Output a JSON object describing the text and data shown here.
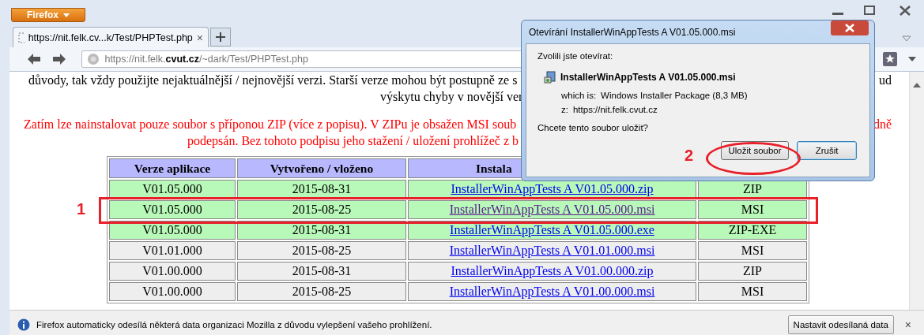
{
  "browser": {
    "menu_button": "Firefox",
    "tab": {
      "title": "https://nit.felk.cv...k/Test/PHPTest.php",
      "close": "×",
      "selected": true
    },
    "url": "https://nit.felk.**cvut.cz**/~dark/Test/PHPTest.php"
  },
  "page": {
    "lines": [
      {
        "kind": "black",
        "text": "důvody, tak vždy použijte nejaktuálnější / nejnovější verzi. Starší verze mohou být postupně ze s",
        "tail": "ud"
      },
      {
        "kind": "black",
        "text": "výskytu chyby v novější ver"
      },
      {
        "kind": "red",
        "text": "Zatím lze nainstalovat pouze soubor s příponou ZIP (více z popisu). V ZIPu je obsažen MSI soub",
        "tail": "dně"
      },
      {
        "kind": "red",
        "text": "podepsán. Bez tohoto podpisu jeho stažení / uložení prohlížeč z b"
      }
    ]
  },
  "table": {
    "columns": [
      "Verze aplikace",
      "Vytvořeno / vloženo",
      "Instala",
      ""
    ],
    "rows": [
      {
        "color": "#b8f8b8",
        "cells": [
          "V01.05.000",
          "2015-08-31",
          "InstallerWinAppTests A V01.05.000.zip",
          "ZIP"
        ],
        "visited": false
      },
      {
        "color": "#b8f8b8",
        "cells": [
          "V01.05.000",
          "2015-08-25",
          "InstallerWinAppTests A V01.05.000.msi",
          "MSI"
        ],
        "visited": true
      },
      {
        "color": "#b8f8b8",
        "cells": [
          "V01.05.000",
          "2015-08-31",
          "InstallerWinAppTests A V01.05.000.exe",
          "ZIP-EXE"
        ],
        "visited": false
      },
      {
        "color": "#eeeeee",
        "cells": [
          "V01.01.000",
          "2015-08-25",
          "InstallerWinAppTests A V01.01.000.msi",
          "MSI"
        ],
        "visited": false
      },
      {
        "color": "#eeeeee",
        "cells": [
          "V01.00.000",
          "2015-08-31",
          "InstallerWinAppTests A V01.00.000.zip",
          "ZIP"
        ],
        "visited": false
      },
      {
        "color": "#eeeeee",
        "cells": [
          "V01.00.000",
          "2015-08-25",
          "InstallerWinAppTests A V01.00.000.msi",
          "MSI"
        ],
        "visited": false
      }
    ]
  },
  "dialog": {
    "title": "Otevírání InstallerWinAppTests A V01.05.000.msi",
    "prompt": "Zvolili jste otevírat:",
    "filename": "InstallerWinAppTests A V01.05.000.msi",
    "type_label": "which is:",
    "type_value": "Windows Installer Package (8,3 MB)",
    "from_label": "z:",
    "from_value": "https://nit.felk.cvut.cz",
    "question": "Chcete tento soubor uložit?",
    "buttons": [
      {
        "label": "Uložit soubor",
        "default": false
      },
      {
        "label": "Zrušit",
        "default": true
      }
    ]
  },
  "annotations": [
    {
      "kind": "rectangle",
      "label": "1"
    },
    {
      "kind": "ellipse",
      "label": "2"
    }
  ],
  "notification": {
    "text": "Firefox automaticky odesílá některá data organizaci Mozilla z důvodu vylepšení vašeho prohlížení.",
    "button": "Nastavit odesílaná data",
    "close": "×"
  }
}
